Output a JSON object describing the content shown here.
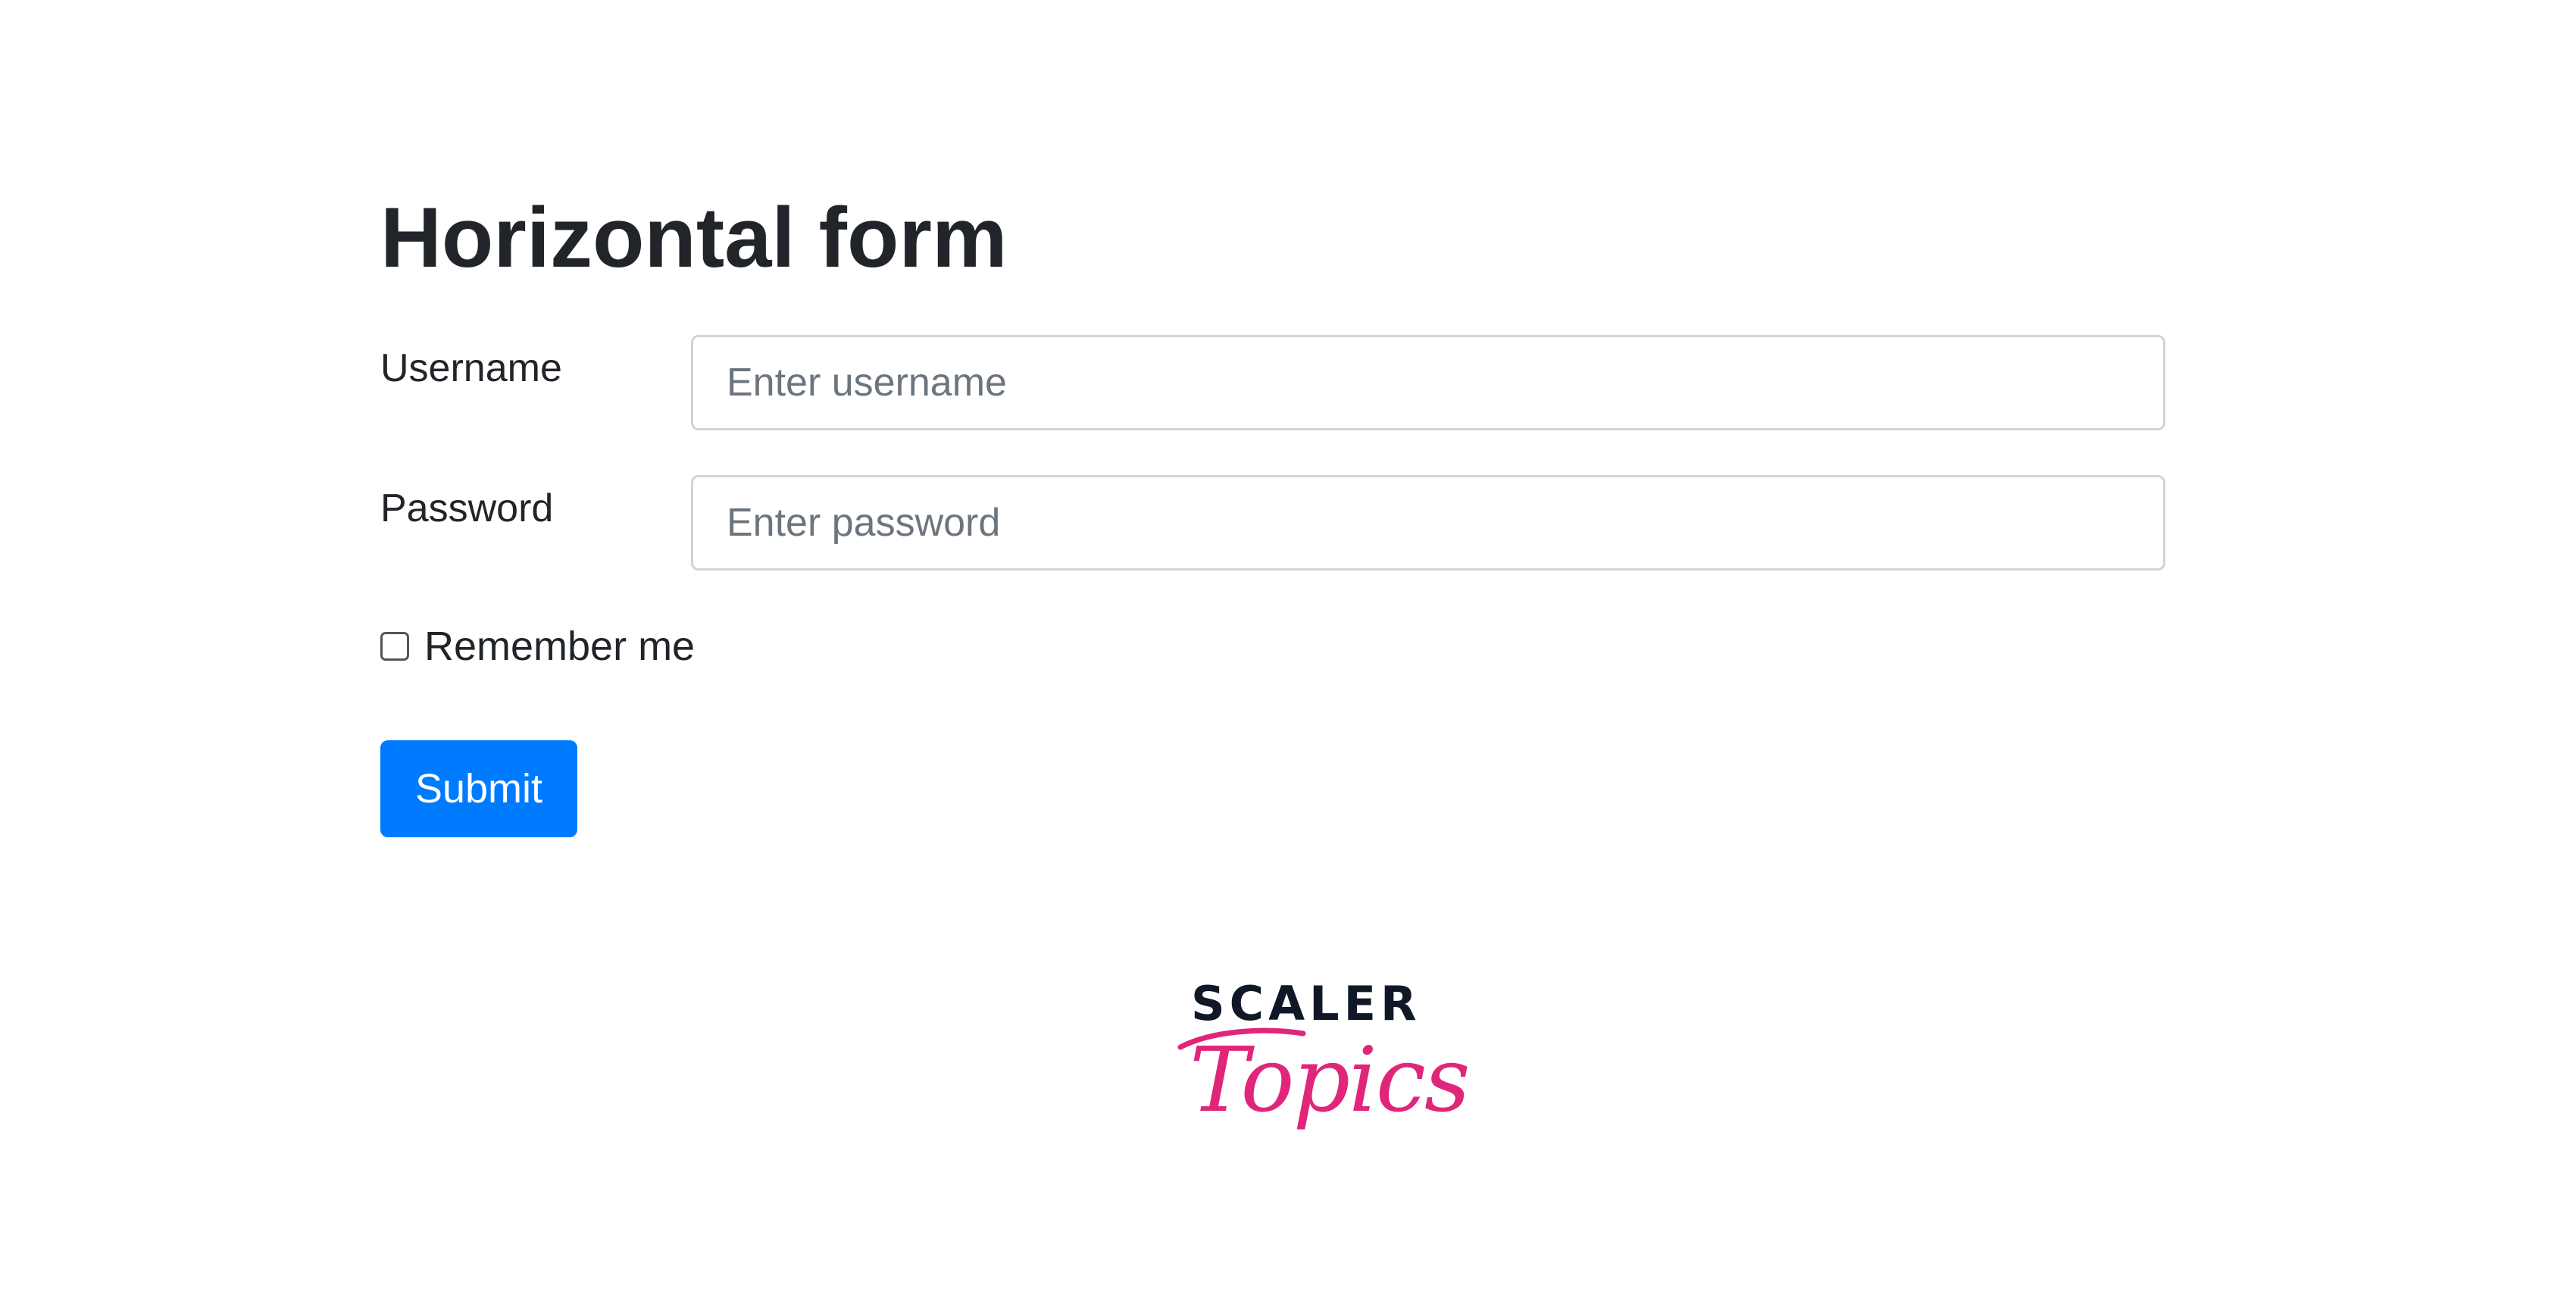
{
  "page": {
    "title": "Horizontal form"
  },
  "form": {
    "username_label": "Username",
    "username_placeholder": "Enter username",
    "username_value": "",
    "password_label": "Password",
    "password_placeholder": "Enter password",
    "password_value": "",
    "remember_label": "Remember me",
    "remember_checked": false,
    "submit_label": "Submit"
  },
  "logo": {
    "line1": "SCALER",
    "line2": "Topics"
  },
  "colors": {
    "primary_button": "#007bff",
    "text": "#212529",
    "input_border": "#ced4da",
    "placeholder": "#6c757d",
    "logo_dark": "#101828",
    "logo_pink": "#e0267a"
  }
}
